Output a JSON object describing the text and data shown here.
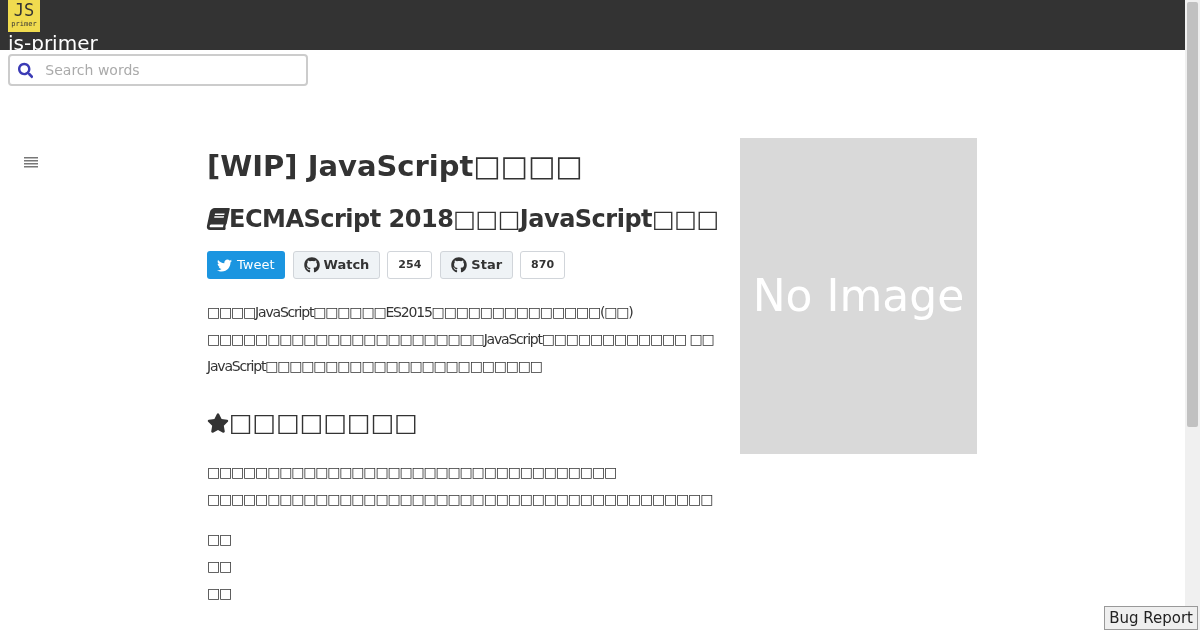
{
  "header": {
    "logo_main": "JS",
    "logo_sub": "primer",
    "site_title": "js-primer"
  },
  "search": {
    "placeholder": "Search words"
  },
  "title": "[WIP] JavaScript□□□□",
  "subtitle": "ECMAScript 2018□□□JavaScript□□□",
  "social": [
    {
      "kind": "tweet",
      "label": "Tweet"
    },
    {
      "kind": "github",
      "label": "Watch",
      "count": "254"
    },
    {
      "kind": "github",
      "label": "Star",
      "count": "870"
    }
  ],
  "intro": [
    "□□□□JavaScript□□□□□□ES2015□□□□□□□□□□□□□□(□□)",
    "□□□□□□□□□□□□□□□□□□□□□□□JavaScript□□□□□□□□□□□□ □□",
    "JavaScript□□□□□□□□□□□□□□□□□□□□□□□"
  ],
  "section_heading": "□□□□□□□□",
  "section_lines": [
    "□□□□□□□□□□□□□□□□□□□□□□□□□□□□□□□□□□",
    "□□□□□□□□□□□□□□□□□□□□□□□□□□□□□□□□□□□□□□□□□□"
  ],
  "short_lines": [
    "□□",
    "□□",
    "□□"
  ],
  "cover": {
    "text": "No Image"
  },
  "bug_report": "Bug Report"
}
